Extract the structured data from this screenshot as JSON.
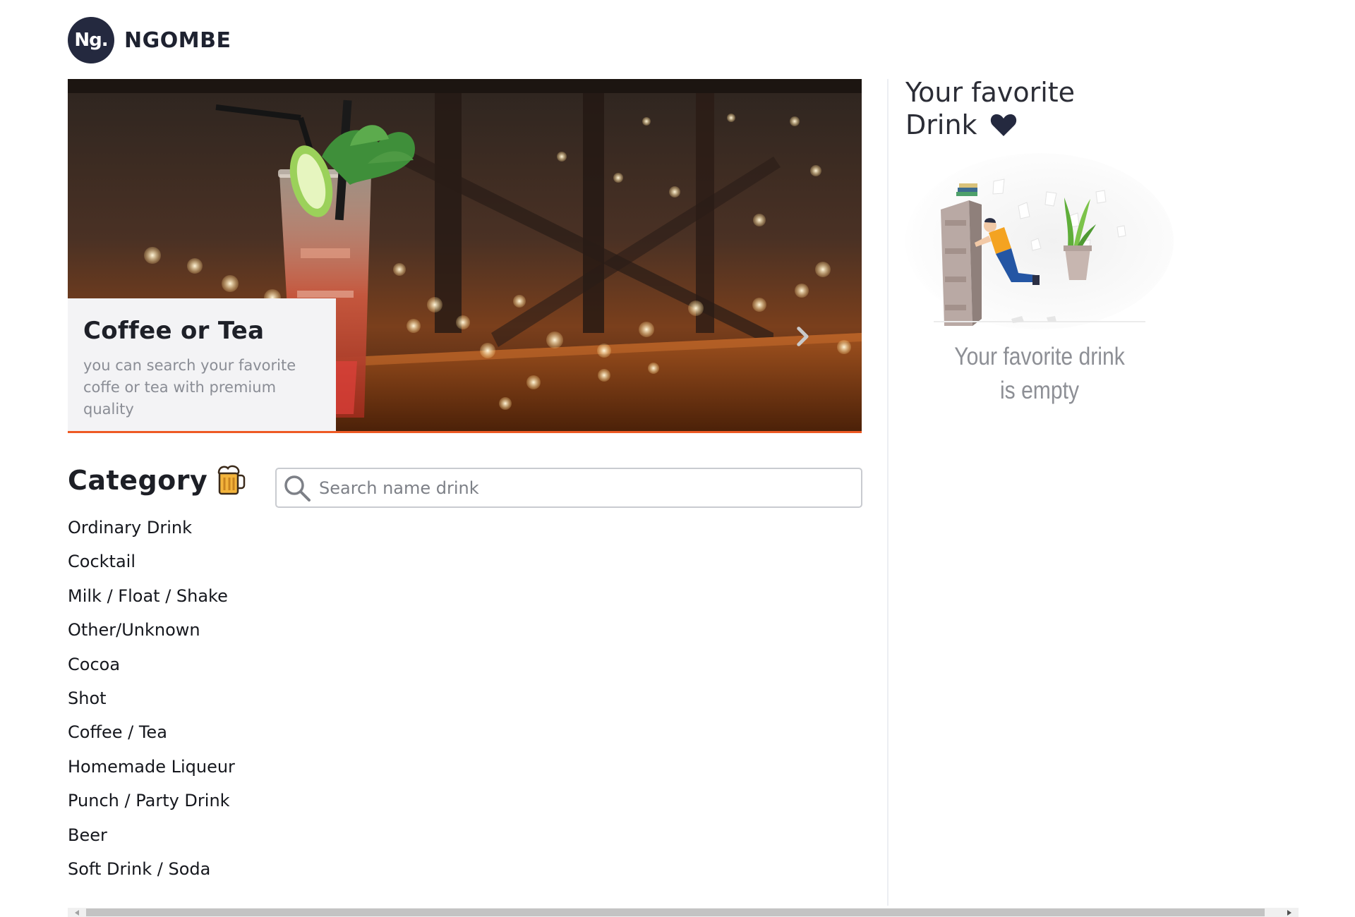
{
  "brand": {
    "logo_text": "Ng.",
    "name": "NGOMBE"
  },
  "carousel": {
    "slide": {
      "title": "Coffee or Tea",
      "text": "you can search  your favorite coffe or tea with premium quality"
    },
    "accent_color": "#ee5a24"
  },
  "category": {
    "title": "Category",
    "icon": "beer-mug-icon",
    "items": [
      "Ordinary Drink",
      "Cocktail",
      "Milk / Float / Shake",
      "Other/Unknown",
      "Cocoa",
      "Shot",
      "Coffee / Tea",
      "Homemade Liqueur",
      "Punch / Party Drink",
      "Beer",
      "Soft Drink / Soda"
    ]
  },
  "search": {
    "placeholder": "Search name drink",
    "value": ""
  },
  "favorites": {
    "title_line1": "Your favorite",
    "title_line2": "Drink",
    "icon": "heart-icon",
    "empty_line1": "Your favorite drink",
    "empty_line2": "is empty"
  },
  "colors": {
    "brand_dark": "#24293f",
    "accent": "#ee5a24"
  }
}
